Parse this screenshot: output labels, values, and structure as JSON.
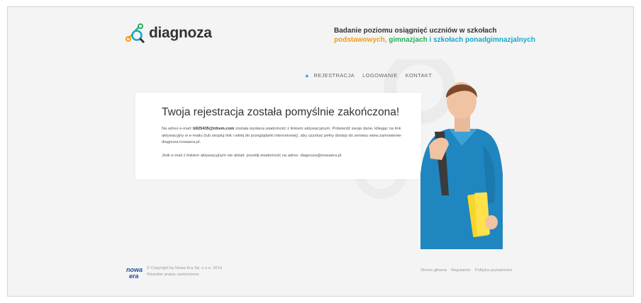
{
  "brand": {
    "name": "diagnoza"
  },
  "tagline": {
    "line1": "Badanie poziomu osiągnięć uczniów w szkołach",
    "part_orange": "podstawowych, ",
    "part_green": "gimnazjach",
    "part_cyan": " i szkołach ponadgimnazjalnych"
  },
  "nav": {
    "items": [
      "REJESTRACJA",
      "LOGOWANIE",
      "KONTAKT"
    ]
  },
  "message": {
    "title": "Twoja rejestracja została pomyślnie zakończona!",
    "p1_before": "Na adres e-mail: ",
    "email": "b925435@trbvm.com",
    "p1_after": " została wysłana wiadomość z linkiem aktywacyjnym. Potwierdź swoje dane, klikając na link aktywacyjny w e-mailu (lub skopiuj link i wklej do przeglądarki internetowej), aby uzyskać pełny dostęp do serwisu www.zamowienie-diagnoza.nowaera.pl.",
    "p2": "Jeśli e-mail z linkiem aktywacyjnym nie dotarł, prześlij wiadomość na adres: diagnoza@nowaera.pl"
  },
  "footer": {
    "logo_top": "nowa",
    "logo_bottom": "era",
    "copyright": "© Copyright by Nowa Era Sp. z o.o. 2014",
    "rights": "Wszelkie prawa zastrzeżone.",
    "links": [
      "Strona główna",
      "Regulamin",
      "Polityka prywatności"
    ]
  },
  "colors": {
    "orange": "#f39c12",
    "green": "#27ae60",
    "cyan": "#16a9cc",
    "nav_accent": "#2aa6d9"
  }
}
